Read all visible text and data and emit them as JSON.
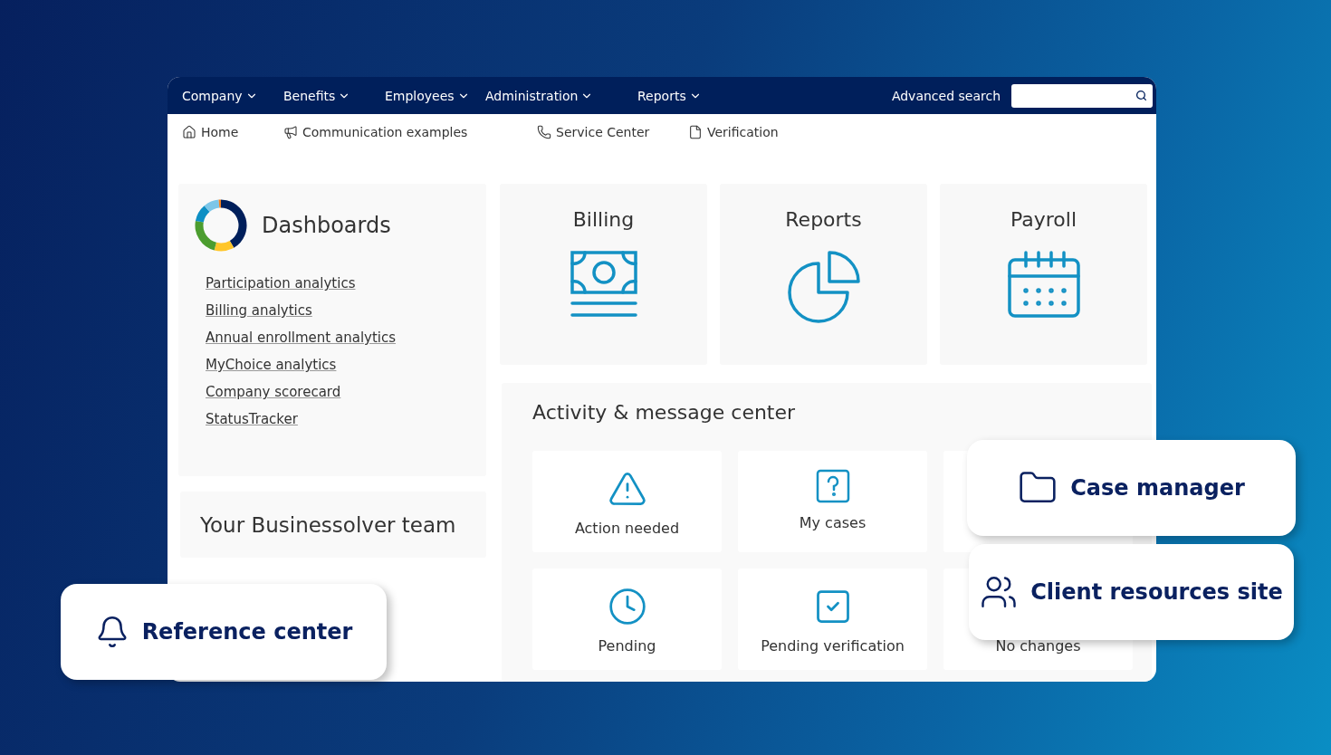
{
  "nav": {
    "menus": [
      {
        "label": "Company"
      },
      {
        "label": "Benefits"
      },
      {
        "label": "Employees"
      },
      {
        "label": "Administration"
      },
      {
        "label": "Reports"
      }
    ],
    "search_label": "Advanced search"
  },
  "shortcuts": [
    {
      "label": "Home"
    },
    {
      "label": "Communication examples"
    },
    {
      "label": "Service Center"
    },
    {
      "label": "Verification"
    }
  ],
  "dashboards": {
    "title": "Dashboards",
    "links": [
      "Participation analytics",
      "Billing analytics",
      "Annual enrollment analytics",
      "MyChoice analytics",
      "Company scorecard",
      "StatusTracker"
    ]
  },
  "team": {
    "title": "Your Businessolver team"
  },
  "tiles": [
    {
      "label": "Billing"
    },
    {
      "label": "Reports"
    },
    {
      "label": "Payroll"
    }
  ],
  "activity": {
    "title": "Activity & message center",
    "items": [
      {
        "kind": "full",
        "label": "Action needed"
      },
      {
        "kind": "full",
        "label": "My cases"
      },
      {
        "kind": "covered"
      },
      {
        "kind": "full",
        "label": "Pending"
      },
      {
        "kind": "full",
        "label": "Pending verification"
      },
      {
        "kind": "text",
        "label": "No changes"
      }
    ]
  },
  "callouts": [
    {
      "label": "Reference center"
    },
    {
      "label": "Case manager"
    },
    {
      "label": "Client resources site"
    }
  ]
}
